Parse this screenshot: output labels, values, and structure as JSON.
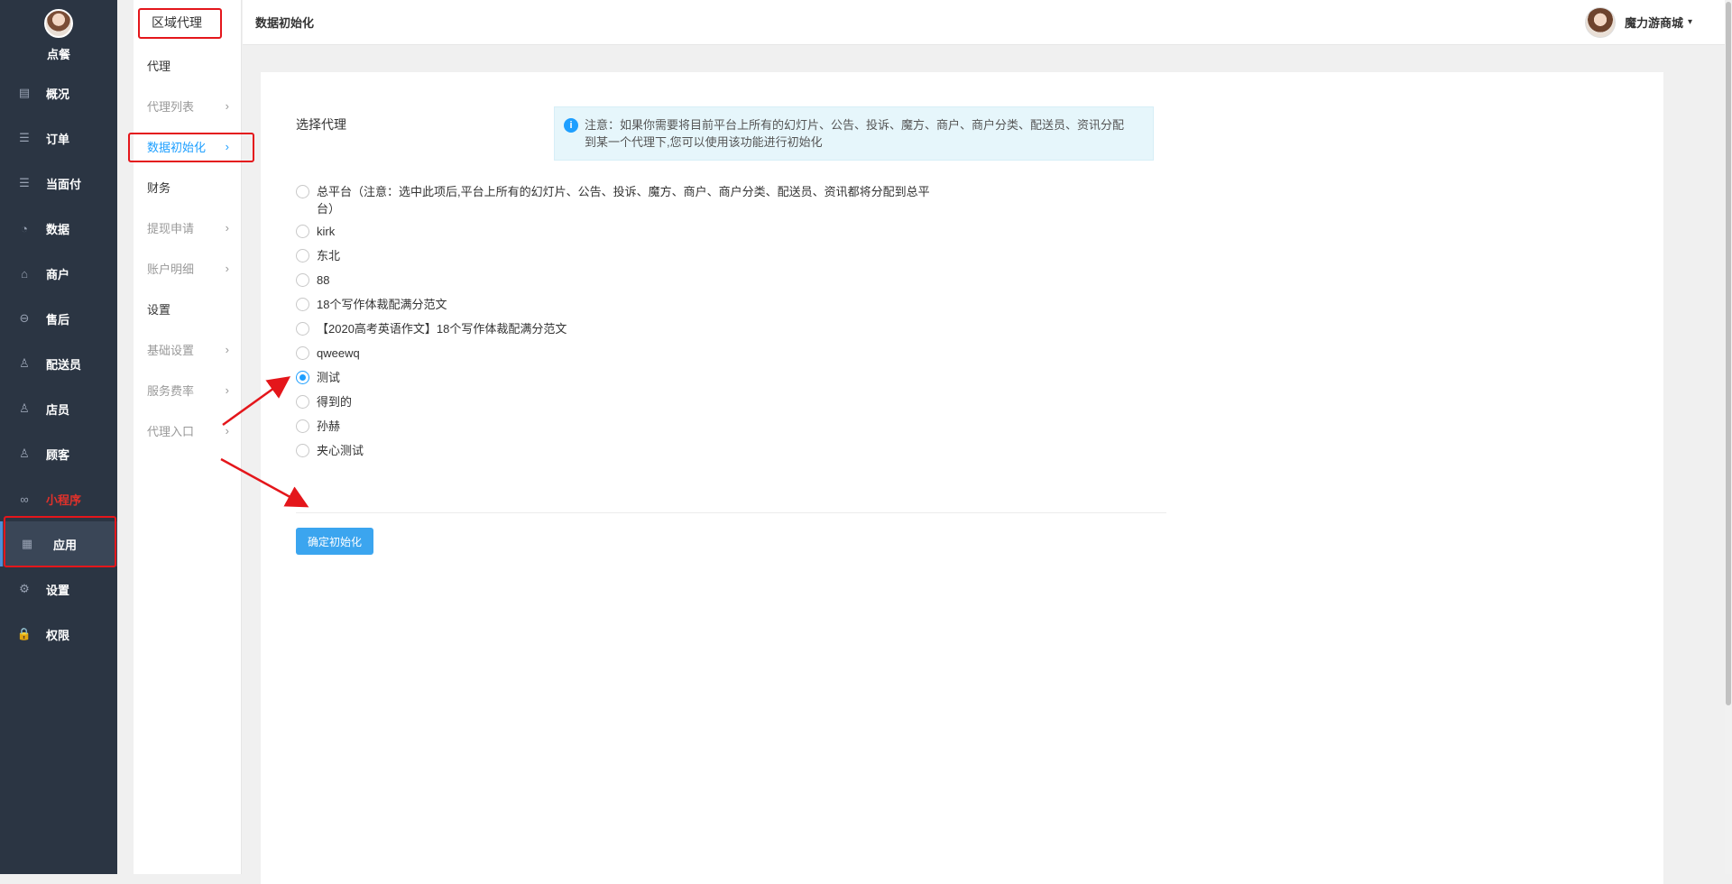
{
  "sidebar": {
    "shop_name": "点餐",
    "items": [
      {
        "label": "概况",
        "icon": "overview-icon",
        "glyph": "▤"
      },
      {
        "label": "订单",
        "icon": "order-icon",
        "glyph": "☰"
      },
      {
        "label": "当面付",
        "icon": "pay-icon",
        "glyph": "☰"
      },
      {
        "label": "数据",
        "icon": "chart-icon",
        "glyph": "◔"
      },
      {
        "label": "商户",
        "icon": "store-icon",
        "glyph": "⌂"
      },
      {
        "label": "售后",
        "icon": "aftersale-icon",
        "glyph": "⊖"
      },
      {
        "label": "配送员",
        "icon": "courier-icon",
        "glyph": "♙"
      },
      {
        "label": "店员",
        "icon": "clerk-icon",
        "glyph": "♙"
      },
      {
        "label": "顾客",
        "icon": "customer-icon",
        "glyph": "♙"
      },
      {
        "label": "小程序",
        "icon": "miniprogram-icon",
        "glyph": "∞"
      },
      {
        "label": "应用",
        "icon": "apps-icon",
        "glyph": "▦"
      },
      {
        "label": "设置",
        "icon": "settings-icon",
        "glyph": "⚙"
      },
      {
        "label": "权限",
        "icon": "lock-icon",
        "glyph": "🔒"
      }
    ]
  },
  "submenu": {
    "heading": "区域代理",
    "items": [
      {
        "label": "代理",
        "chevron": ""
      },
      {
        "label": "代理列表",
        "chevron": "›"
      },
      {
        "label": "数据初始化",
        "chevron": "›"
      },
      {
        "label": "财务",
        "chevron": ""
      },
      {
        "label": "提现申请",
        "chevron": "›"
      },
      {
        "label": "账户明细",
        "chevron": "›"
      },
      {
        "label": "设置",
        "chevron": ""
      },
      {
        "label": "基础设置",
        "chevron": "›"
      },
      {
        "label": "服务费率",
        "chevron": "›"
      },
      {
        "label": "代理入口",
        "chevron": "›"
      }
    ]
  },
  "topbar": {
    "title": "数据初始化",
    "user_name": "魔力游商城",
    "caret": "▾"
  },
  "form": {
    "label": "选择代理",
    "notice_icon": "i",
    "notice": "注意：如果你需要将目前平台上所有的幻灯片、公告、投诉、魔方、商户、商户分类、配送员、资讯分配到某一个代理下,您可以使用该功能进行初始化",
    "options": [
      {
        "label": "总平台（注意：选中此项后,平台上所有的幻灯片、公告、投诉、魔方、商户、商户分类、配送员、资讯都将分配到总平台）",
        "checked": false
      },
      {
        "label": "kirk",
        "checked": false
      },
      {
        "label": "东北",
        "checked": false
      },
      {
        "label": "88",
        "checked": false
      },
      {
        "label": "18个写作体裁配满分范文",
        "checked": false
      },
      {
        "label": "【2020高考英语作文】18个写作体裁配满分范文",
        "checked": false
      },
      {
        "label": "qweewq",
        "checked": false
      },
      {
        "label": "测试",
        "checked": true
      },
      {
        "label": "得到的",
        "checked": false
      },
      {
        "label": "孙赫",
        "checked": false
      },
      {
        "label": "夹心测试",
        "checked": false
      }
    ],
    "confirm_label": "确定初始化"
  },
  "colors": {
    "sidebar_bg": "#2b3543",
    "accent": "#1e9fff",
    "highlight": "#e4161b",
    "button": "#3ba5ef"
  }
}
